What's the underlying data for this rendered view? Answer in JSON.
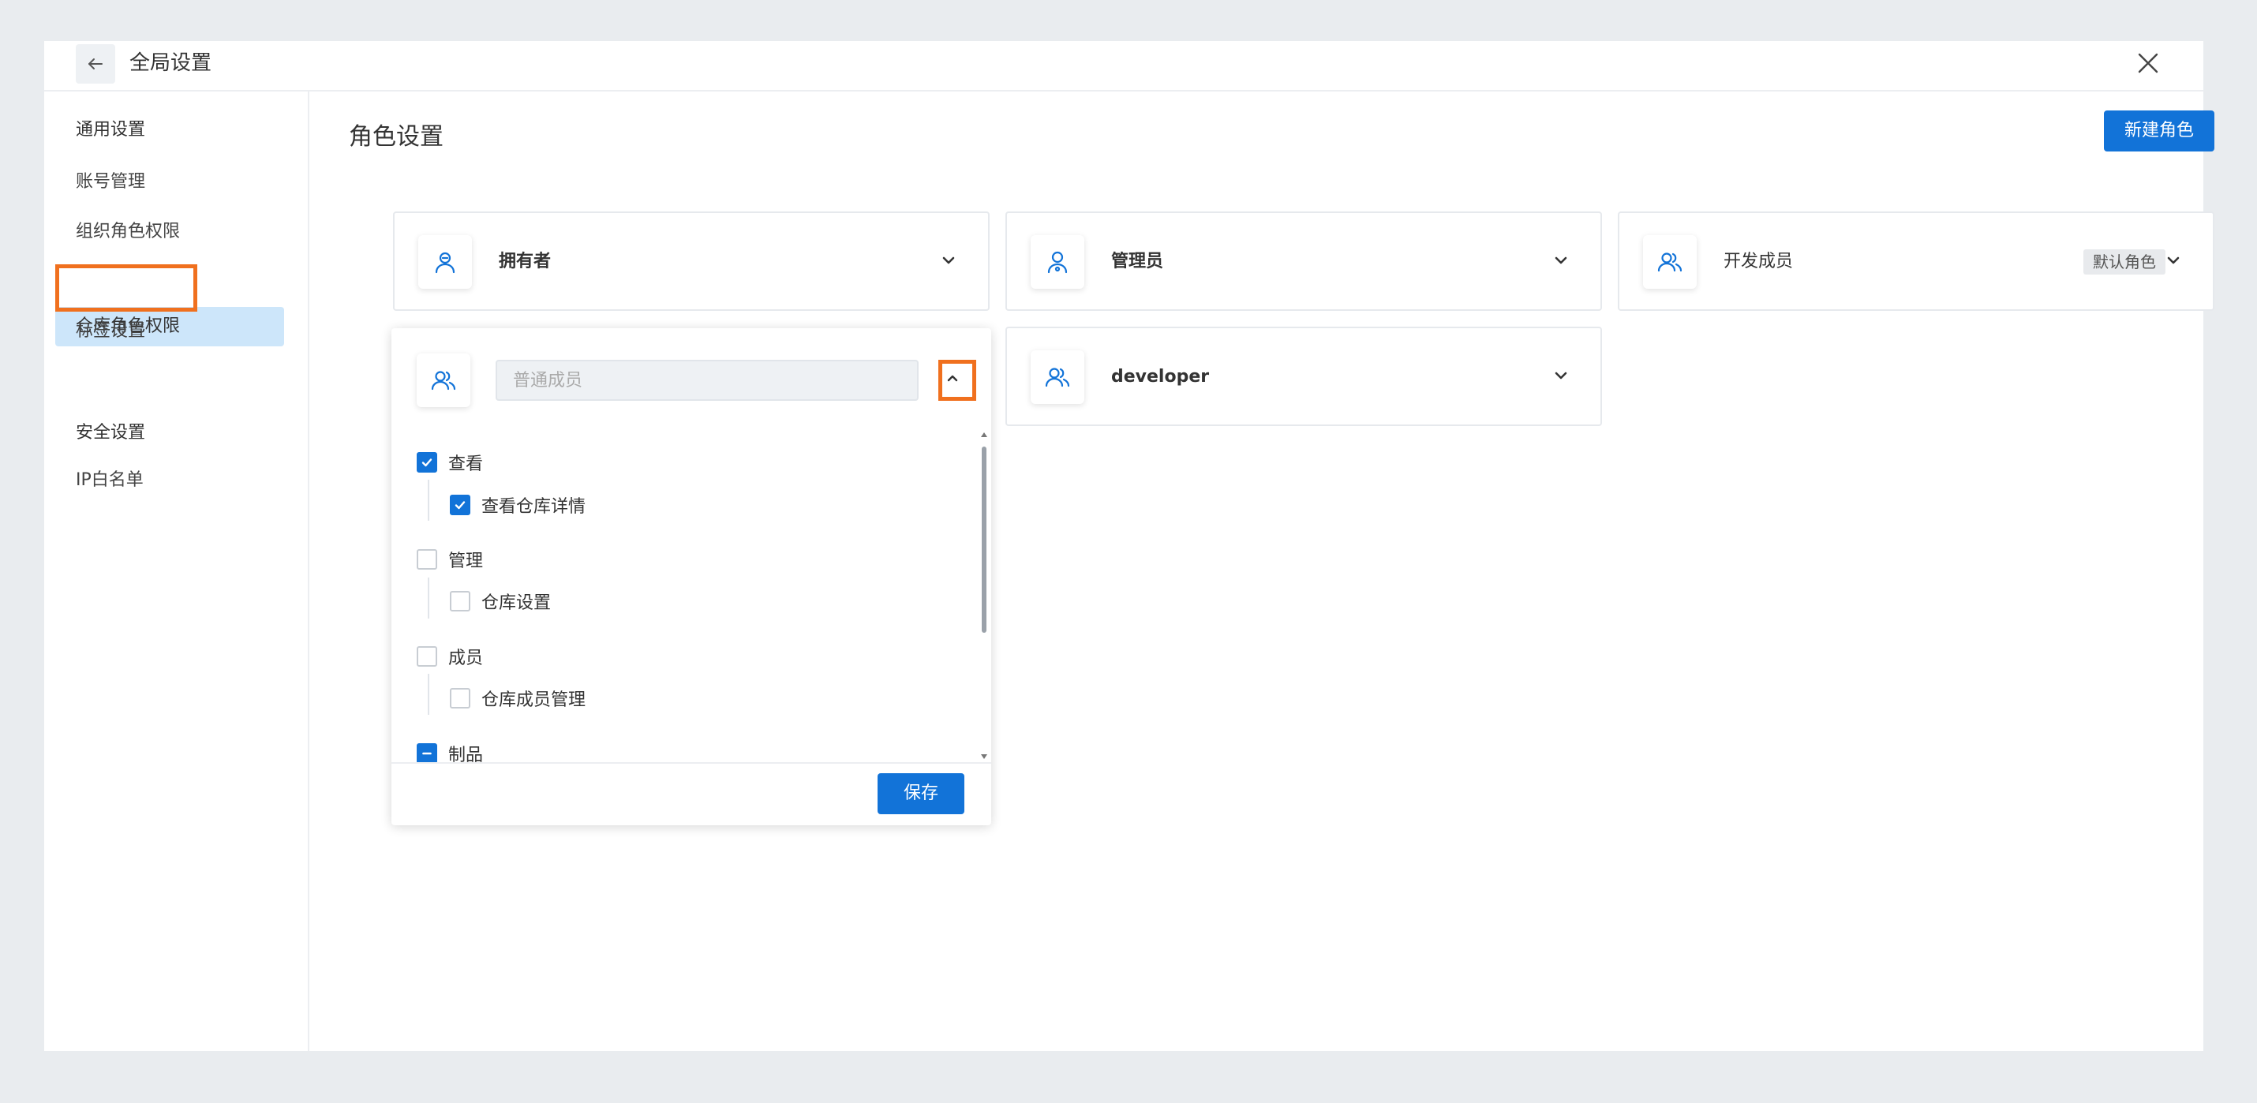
{
  "window": {
    "title": "全局设置"
  },
  "sidebar": {
    "group_general": "通用设置",
    "items_general": [
      {
        "label": "账号管理"
      },
      {
        "label": "组织角色权限"
      },
      {
        "label": "仓库角色权限",
        "active": true
      },
      {
        "label": "标签设置"
      }
    ],
    "group_security": "安全设置",
    "items_security": [
      {
        "label": "IP白名单"
      }
    ]
  },
  "main": {
    "title": "角色设置",
    "new_role_label": "新建角色",
    "roles": [
      {
        "name": "拥有者",
        "icon": "user-crown-icon"
      },
      {
        "name": "管理员",
        "icon": "user-admin-icon"
      },
      {
        "name": "开发成员",
        "icon": "users-icon",
        "tag": "默认角色"
      },
      {
        "name": "developer",
        "icon": "users-icon"
      }
    ],
    "editor": {
      "icon": "users-icon",
      "input_placeholder": "普通成员",
      "groups": [
        {
          "label": "查看",
          "state": "checked",
          "children": [
            {
              "label": "查看仓库详情",
              "state": "checked"
            }
          ]
        },
        {
          "label": "管理",
          "state": "unchecked",
          "children": [
            {
              "label": "仓库设置",
              "state": "unchecked"
            }
          ]
        },
        {
          "label": "成员",
          "state": "unchecked",
          "children": [
            {
              "label": "仓库成员管理",
              "state": "unchecked"
            }
          ]
        },
        {
          "label": "制品",
          "state": "partial",
          "children": []
        }
      ],
      "save_label": "保存"
    }
  },
  "colors": {
    "accent": "#1273d8",
    "highlight": "#f0701e",
    "active_bg": "#cde6fa"
  }
}
